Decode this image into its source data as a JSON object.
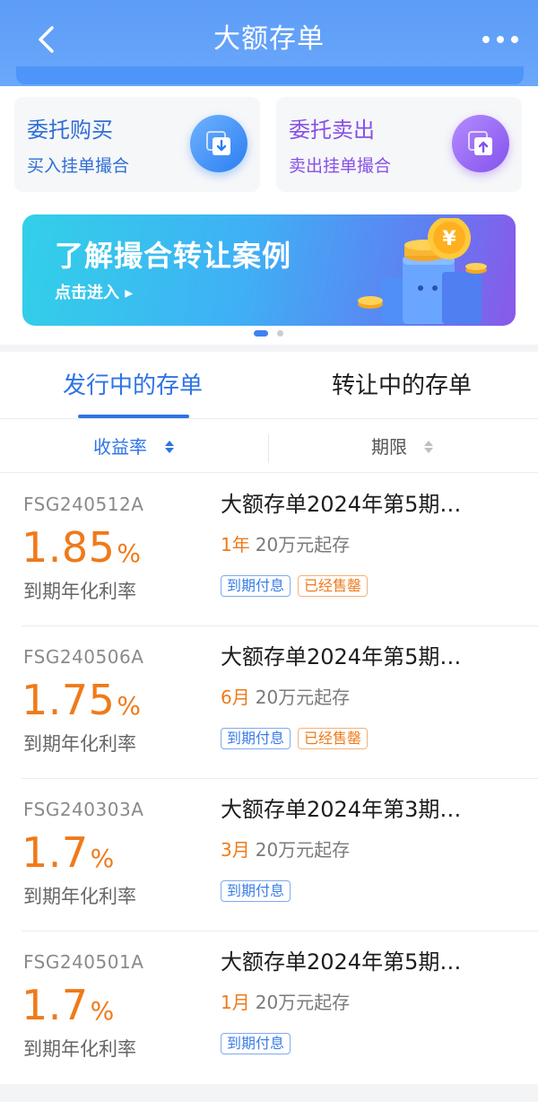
{
  "header": {
    "title": "大额存单"
  },
  "actions": {
    "buy": {
      "title": "委托购买",
      "subtitle": "买入挂单撮合"
    },
    "sell": {
      "title": "委托卖出",
      "subtitle": "卖出挂单撮合"
    }
  },
  "banner": {
    "title": "了解撮合转让案例",
    "link": "点击进入 ▸",
    "coin_symbol": "¥"
  },
  "carousel": {
    "total": 2,
    "active": 1
  },
  "tabs": [
    {
      "label": "发行中的存单",
      "active": true
    },
    {
      "label": "转让中的存单",
      "active": false
    }
  ],
  "sort": {
    "rate_label": "收益率",
    "term_label": "期限"
  },
  "products": [
    {
      "code": "FSG240512A",
      "rate": "1.85",
      "rate_unit": "%",
      "rate_label": "到期年化利率",
      "name": "大额存单2024年第5期…",
      "term": "1年",
      "min_amount": "20万元起存",
      "tags": [
        {
          "text": "到期付息",
          "style": "blue"
        },
        {
          "text": "已经售罄",
          "style": "orange"
        }
      ]
    },
    {
      "code": "FSG240506A",
      "rate": "1.75",
      "rate_unit": "%",
      "rate_label": "到期年化利率",
      "name": "大额存单2024年第5期…",
      "term": "6月",
      "min_amount": "20万元起存",
      "tags": [
        {
          "text": "到期付息",
          "style": "blue"
        },
        {
          "text": "已经售罄",
          "style": "orange"
        }
      ]
    },
    {
      "code": "FSG240303A",
      "rate": "1.7",
      "rate_unit": "%",
      "rate_label": "到期年化利率",
      "name": "大额存单2024年第3期…",
      "term": "3月",
      "min_amount": "20万元起存",
      "tags": [
        {
          "text": "到期付息",
          "style": "blue"
        }
      ]
    },
    {
      "code": "FSG240501A",
      "rate": "1.7",
      "rate_unit": "%",
      "rate_label": "到期年化利率",
      "name": "大额存单2024年第5期…",
      "term": "1月",
      "min_amount": "20万元起存",
      "tags": [
        {
          "text": "到期付息",
          "style": "blue"
        }
      ]
    }
  ],
  "colors": {
    "primary": "#2e73e6",
    "accent_orange": "#ef7a1a",
    "header_blue": "#5d9cf7",
    "sell_purple": "#8750e6"
  }
}
